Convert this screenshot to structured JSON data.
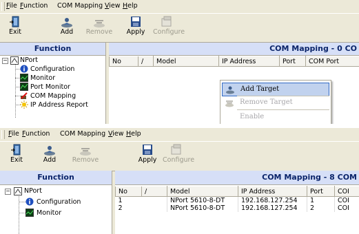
{
  "top": {
    "menubar": {
      "items": [
        {
          "ul": "F",
          "rest": "ile"
        },
        {
          "ul": "F",
          "rest": "unction"
        },
        {
          "ul": "",
          "rest": "COM Mapping"
        },
        {
          "ul": "V",
          "rest": "iew"
        },
        {
          "ul": "H",
          "rest": "elp"
        }
      ]
    },
    "toolbar": {
      "exit": "Exit",
      "add": "Add",
      "remove": "Remove",
      "apply": "Apply",
      "configure": "Configure"
    },
    "left_title": "Function",
    "right_title": "COM Mapping - 0 CO",
    "tree": {
      "root": "NPort",
      "items": [
        "Configuration",
        "Monitor",
        "Port Monitor",
        "COM Mapping",
        "IP Address Report"
      ]
    },
    "table": {
      "columns": [
        "No",
        "/",
        "Model",
        "IP Address",
        "Port",
        "COM Port"
      ]
    },
    "context_menu": {
      "add_target": "Add Target",
      "remove_target": "Remove Target",
      "enable": "Enable"
    }
  },
  "bottom": {
    "menubar": {
      "items": [
        {
          "ul": "F",
          "rest": "ile"
        },
        {
          "ul": "F",
          "rest": "unction"
        },
        {
          "ul": "",
          "rest": "COM Mapping"
        },
        {
          "ul": "V",
          "rest": "iew"
        },
        {
          "ul": "H",
          "rest": "elp"
        }
      ]
    },
    "toolbar": {
      "exit": "Exit",
      "add": "Add",
      "remove": "Remove",
      "apply": "Apply",
      "configure": "Configure"
    },
    "left_title": "Function",
    "right_title": "COM Mapping - 8 COM",
    "tree": {
      "root": "NPort",
      "items": [
        "Configuration",
        "Monitor"
      ]
    },
    "table": {
      "columns": [
        "No",
        "/",
        "Model",
        "IP Address",
        "Port",
        "COI"
      ],
      "rows": [
        {
          "no": "1",
          "model": "NPort 5610-8-DT",
          "ip": "192.168.127.254",
          "port": "1",
          "com": "COI"
        },
        {
          "no": "2",
          "model": "NPort 5610-8-DT",
          "ip": "192.168.127.254",
          "port": "2",
          "com": "COI"
        }
      ]
    }
  },
  "colors": {
    "chrome": "#ece9d8",
    "title_band": "#d6dff7",
    "title_text": "#0a246a",
    "menu_highlight": "#c1d2ee"
  },
  "icons": {
    "exit": "exit-door-icon",
    "add": "add-target-icon",
    "remove": "remove-target-icon",
    "apply": "floppy-disk-icon",
    "configure": "configure-icon",
    "root": "nport-server-icon",
    "configuration": "info-icon",
    "monitor": "monitor-icon",
    "port_monitor": "port-monitor-icon",
    "com_mapping": "com-mapping-icon",
    "ip_report": "ip-report-icon"
  }
}
